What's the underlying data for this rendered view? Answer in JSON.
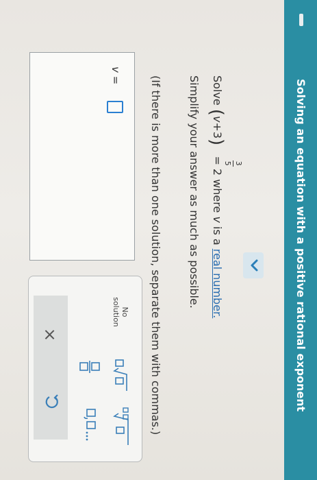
{
  "header": {
    "title": "Solving an equation with a positive rational exponent"
  },
  "problem": {
    "solve_word": "Solve",
    "base_open": "(",
    "base_var": "v",
    "base_rest": "+3",
    "base_close": ")",
    "exponent_num": "3",
    "exponent_den": "5",
    "equals_rhs": "= 2 where",
    "var": "v",
    "is_a": "is a",
    "real_number_link": "real number.",
    "simplify": "Simplify your answer as much as possible.",
    "instruction": "(If there is more than one solution, separate them with commas.)"
  },
  "answer": {
    "label": "v ="
  },
  "keypad": {
    "no_solution_line1": "No",
    "no_solution_line2": "solution",
    "clear_symbol": "×",
    "undo_icon": "undo-icon",
    "sqrt_icon": "square-root-icon",
    "nth_root_icon": "nth-root-icon",
    "fraction_icon": "fraction-icon",
    "list_icon": "comma-list-icon"
  },
  "colors": {
    "banner": "#2a8ea3",
    "link": "#2a6db0",
    "input_border": "#2a7fd1"
  }
}
